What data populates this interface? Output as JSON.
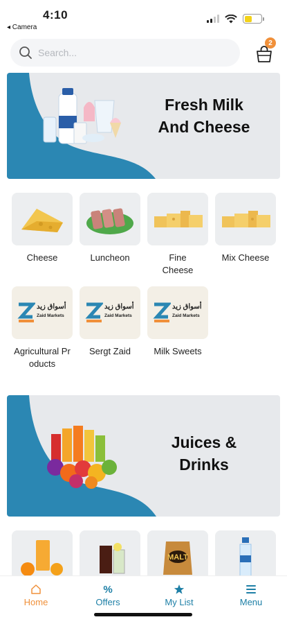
{
  "status": {
    "time": "4:10",
    "back_label": "◂ Camera"
  },
  "search": {
    "placeholder": "Search..."
  },
  "cart": {
    "count": "2"
  },
  "sections": [
    {
      "title_line1": "Fresh Milk",
      "title_line2": "And Cheese",
      "categories": [
        {
          "label": "Cheese",
          "image": "cheese-image"
        },
        {
          "label": "Luncheon",
          "image": "luncheon-image"
        },
        {
          "label": "Fine Cheese",
          "image": "fine-cheese-image"
        },
        {
          "label": "Mix Cheese",
          "image": "mix-cheese-image"
        },
        {
          "label": "Agricultural Products",
          "image": "zaid-markets-logo"
        },
        {
          "label": "Sergt Zaid",
          "image": "zaid-markets-logo"
        },
        {
          "label": "Milk Sweets",
          "image": "zaid-markets-logo"
        }
      ]
    },
    {
      "title_line1": "Juices &",
      "title_line2": "Drinks",
      "categories": [
        {
          "image": "orange-juice-image"
        },
        {
          "image": "soda-drinks-image"
        },
        {
          "image": "malt-drink-image"
        },
        {
          "image": "water-bottle-image"
        }
      ]
    }
  ],
  "logo": {
    "arabic": "أسواق زيد",
    "english": "Zaid Markets"
  },
  "nav": [
    {
      "label": "Home",
      "icon": "home-icon"
    },
    {
      "label": "Offers",
      "icon": "percent-icon"
    },
    {
      "label": "My List",
      "icon": "star-icon"
    },
    {
      "label": "Menu",
      "icon": "menu-icon"
    }
  ],
  "colors": {
    "accent": "#f0903a",
    "primary": "#1d7fa6",
    "banner_wave": "#2b87b3",
    "banner_bg": "#e7e9ec"
  }
}
